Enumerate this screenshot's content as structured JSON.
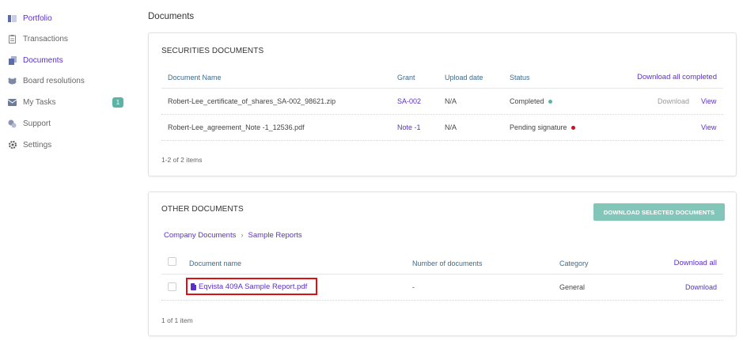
{
  "sidebar": {
    "items": [
      {
        "label": "Portfolio",
        "icon": "portfolio-icon",
        "active": true
      },
      {
        "label": "Transactions",
        "icon": "transactions-icon",
        "active": false
      },
      {
        "label": "Documents",
        "icon": "documents-icon",
        "active": true
      },
      {
        "label": "Board resolutions",
        "icon": "board-resolutions-icon",
        "active": false
      },
      {
        "label": "My Tasks",
        "icon": "tasks-icon",
        "active": false,
        "badge": "1"
      },
      {
        "label": "Support",
        "icon": "support-icon",
        "active": false
      },
      {
        "label": "Settings",
        "icon": "gear-icon",
        "active": false
      }
    ]
  },
  "page_title": "Documents",
  "securities": {
    "title": "SECURITIES DOCUMENTS",
    "columns": {
      "document_name": "Document Name",
      "grant": "Grant",
      "upload_date": "Upload date",
      "status": "Status",
      "download_all": "Download all completed"
    },
    "rows": [
      {
        "name": "Robert-Lee_certificate_of_shares_SA-002_98621.zip",
        "grant": "SA-002",
        "upload_date": "N/A",
        "status": "Completed",
        "status_color": "#5db4a6",
        "download": "Download",
        "view": "View"
      },
      {
        "name": "Robert-Lee_agreement_Note -1_12536.pdf",
        "grant": "Note -1",
        "upload_date": "N/A",
        "status": "Pending signature",
        "status_color": "#c8102e",
        "view": "View"
      }
    ],
    "pagination": "1-2 of 2 items"
  },
  "other": {
    "title": "OTHER DOCUMENTS",
    "download_selected": "DOWNLOAD SELECTED DOCUMENTS",
    "breadcrumb": {
      "root": "Company Documents",
      "separator": "›",
      "current": "Sample Reports"
    },
    "columns": {
      "document_name": "Document name",
      "number_of_documents": "Number of documents",
      "category": "Category",
      "download_all": "Download all"
    },
    "rows": [
      {
        "name": "Eqvista 409A Sample Report.pdf",
        "number": "-",
        "category": "General",
        "download": "Download"
      }
    ],
    "pagination": "1 of 1 item"
  },
  "colors": {
    "accent": "#5b2fc9",
    "teal": "#82c6b9",
    "header_text": "#3d6b8c",
    "highlight_border": "#dd1111"
  }
}
